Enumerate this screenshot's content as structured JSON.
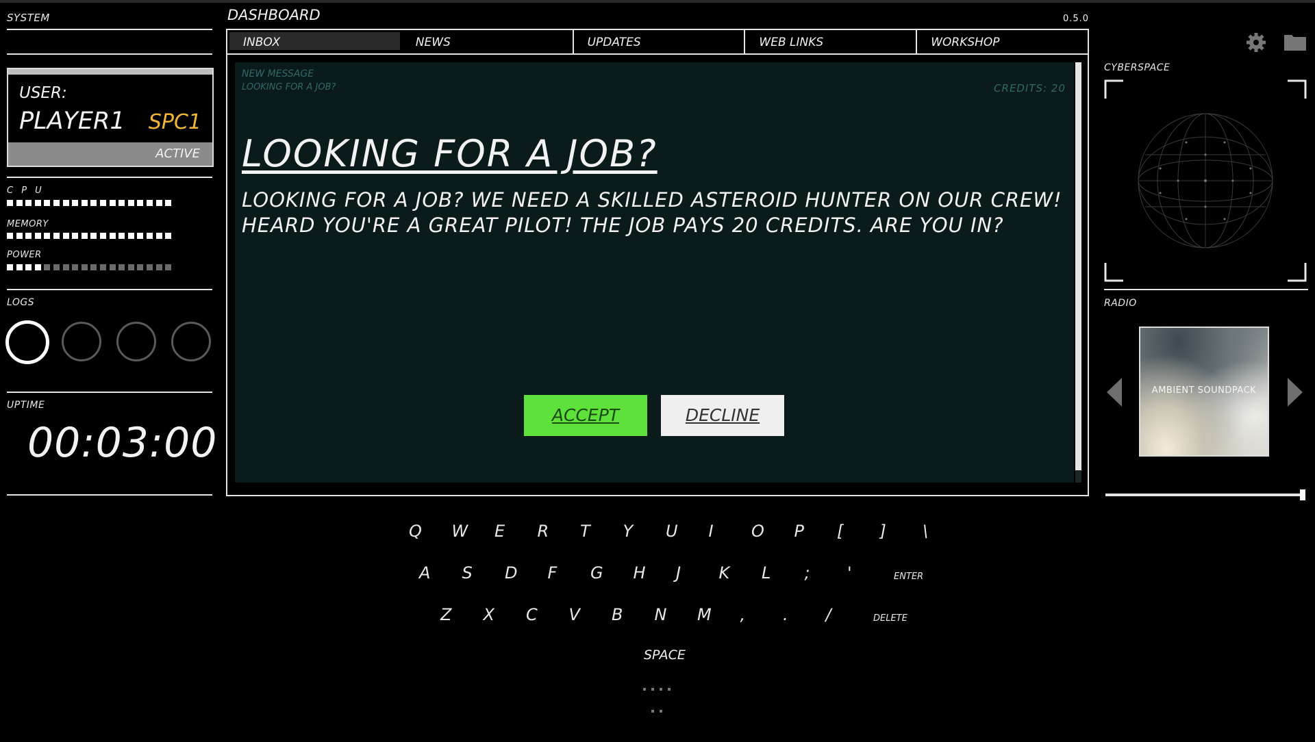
{
  "left": {
    "system_label": "SYSTEM",
    "user_label": "USER:",
    "username": "PLAYER1",
    "user_code": "SPC1",
    "status": "ACTIVE",
    "cpu_label": "C P U",
    "memory_label": "MEMORY",
    "power_label": "POWER",
    "cpu_level": 1.0,
    "memory_level": 1.0,
    "power_level": 0.2,
    "logs_label": "LOGS",
    "uptime_label": "UPTIME",
    "uptime": "00:03:00"
  },
  "dashboard": {
    "title": "DASHBOARD",
    "version": "0.5.0",
    "tabs": [
      "INBOX",
      "NEWS",
      "UPDATES",
      "WEB LINKS",
      "WORKSHOP"
    ],
    "selected_tab": "INBOX",
    "message": {
      "tag": "NEW MESSAGE",
      "subject": "LOOKING FOR A JOB?",
      "credits": "CREDITS: 20",
      "heading": "LOOKING FOR A JOB?",
      "body_line1": "LOOKING FOR A JOB? WE NEED A SKILLED ASTEROID HUNTER ON OUR CREW!",
      "body_line2": "HEARD YOU'RE A GREAT PILOT! THE JOB PAYS 20 CREDITS. ARE YOU IN?",
      "accept": "ACCEPT",
      "decline": "DECLINE"
    }
  },
  "right": {
    "cyberspace_label": "CYBERSPACE",
    "radio_label": "RADIO",
    "track": "AMBIENT SOUNDPACK",
    "volume": 1.0,
    "icons": [
      "gear-icon",
      "folder-icon",
      "prev-arrow-icon",
      "next-arrow-icon"
    ]
  },
  "keyboard": {
    "row1": [
      "Q",
      "W",
      "E",
      "R",
      "T",
      "Y",
      "U",
      "I",
      "O",
      "P",
      "[",
      "]",
      "\\"
    ],
    "row2": [
      "A",
      "S",
      "D",
      "F",
      "G",
      "H",
      "J",
      "K",
      "L",
      ";",
      "'"
    ],
    "row2_enter": "ENTER",
    "row3": [
      "Z",
      "X",
      "C",
      "V",
      "B",
      "N",
      "M",
      ",",
      ".",
      "/"
    ],
    "row3_delete": "DELETE",
    "space": "SPACE"
  },
  "colors": {
    "accept": "#5fe13c",
    "user_code": "#f2b632",
    "message_bg": "#0b1a1a",
    "message_dim": "#2e6a66"
  }
}
